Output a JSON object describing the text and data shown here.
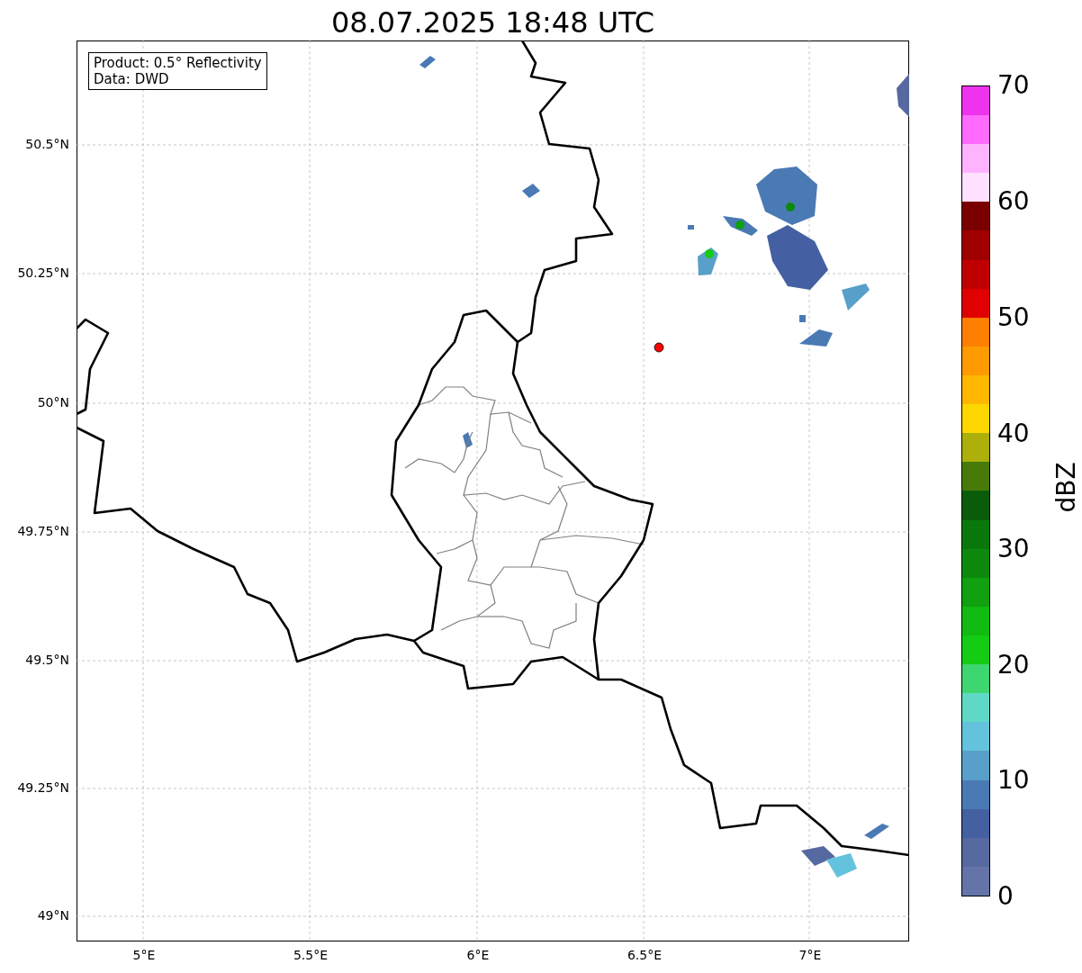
{
  "title": "08.07.2025 18:48 UTC",
  "info_box": {
    "lines": [
      "Product: 0.5° Reflectivity",
      "Data: DWD"
    ]
  },
  "latitude_labels": [
    "50.5°N",
    "50.25°N",
    "50°N",
    "49.75°N",
    "49.5°N",
    "49.25°N",
    "49°N"
  ],
  "longitude_labels": [
    "5°E",
    "5.5°E",
    "6°E",
    "6.5°E",
    "7°E"
  ],
  "colorbar": {
    "label": "dBZ",
    "ticks": [
      "70",
      "60",
      "50",
      "40",
      "30",
      "20",
      "10",
      "0"
    ],
    "bins": [
      {
        "color": "#6474a8"
      },
      {
        "color": "#5669a0"
      },
      {
        "color": "#4460a3"
      },
      {
        "color": "#4a7ab4"
      },
      {
        "color": "#589fc9"
      },
      {
        "color": "#63c2dc"
      },
      {
        "color": "#5fd9c6"
      },
      {
        "color": "#3dd671"
      },
      {
        "color": "#13cc13"
      },
      {
        "color": "#11bb11"
      },
      {
        "color": "#10a010"
      },
      {
        "color": "#0d8a0d"
      },
      {
        "color": "#0b780b"
      },
      {
        "color": "#0a5c0a"
      },
      {
        "color": "#487a0a"
      },
      {
        "color": "#adb00a"
      },
      {
        "color": "#ffd700"
      },
      {
        "color": "#ffb700"
      },
      {
        "color": "#ff9a00"
      },
      {
        "color": "#ff7f00"
      },
      {
        "color": "#e00000"
      },
      {
        "color": "#c00000"
      },
      {
        "color": "#a00000"
      },
      {
        "color": "#7a0000"
      },
      {
        "color": "#ffe0ff"
      },
      {
        "color": "#ffb3ff"
      },
      {
        "color": "#ff6bff"
      },
      {
        "color": "#ee33ee"
      }
    ]
  }
}
